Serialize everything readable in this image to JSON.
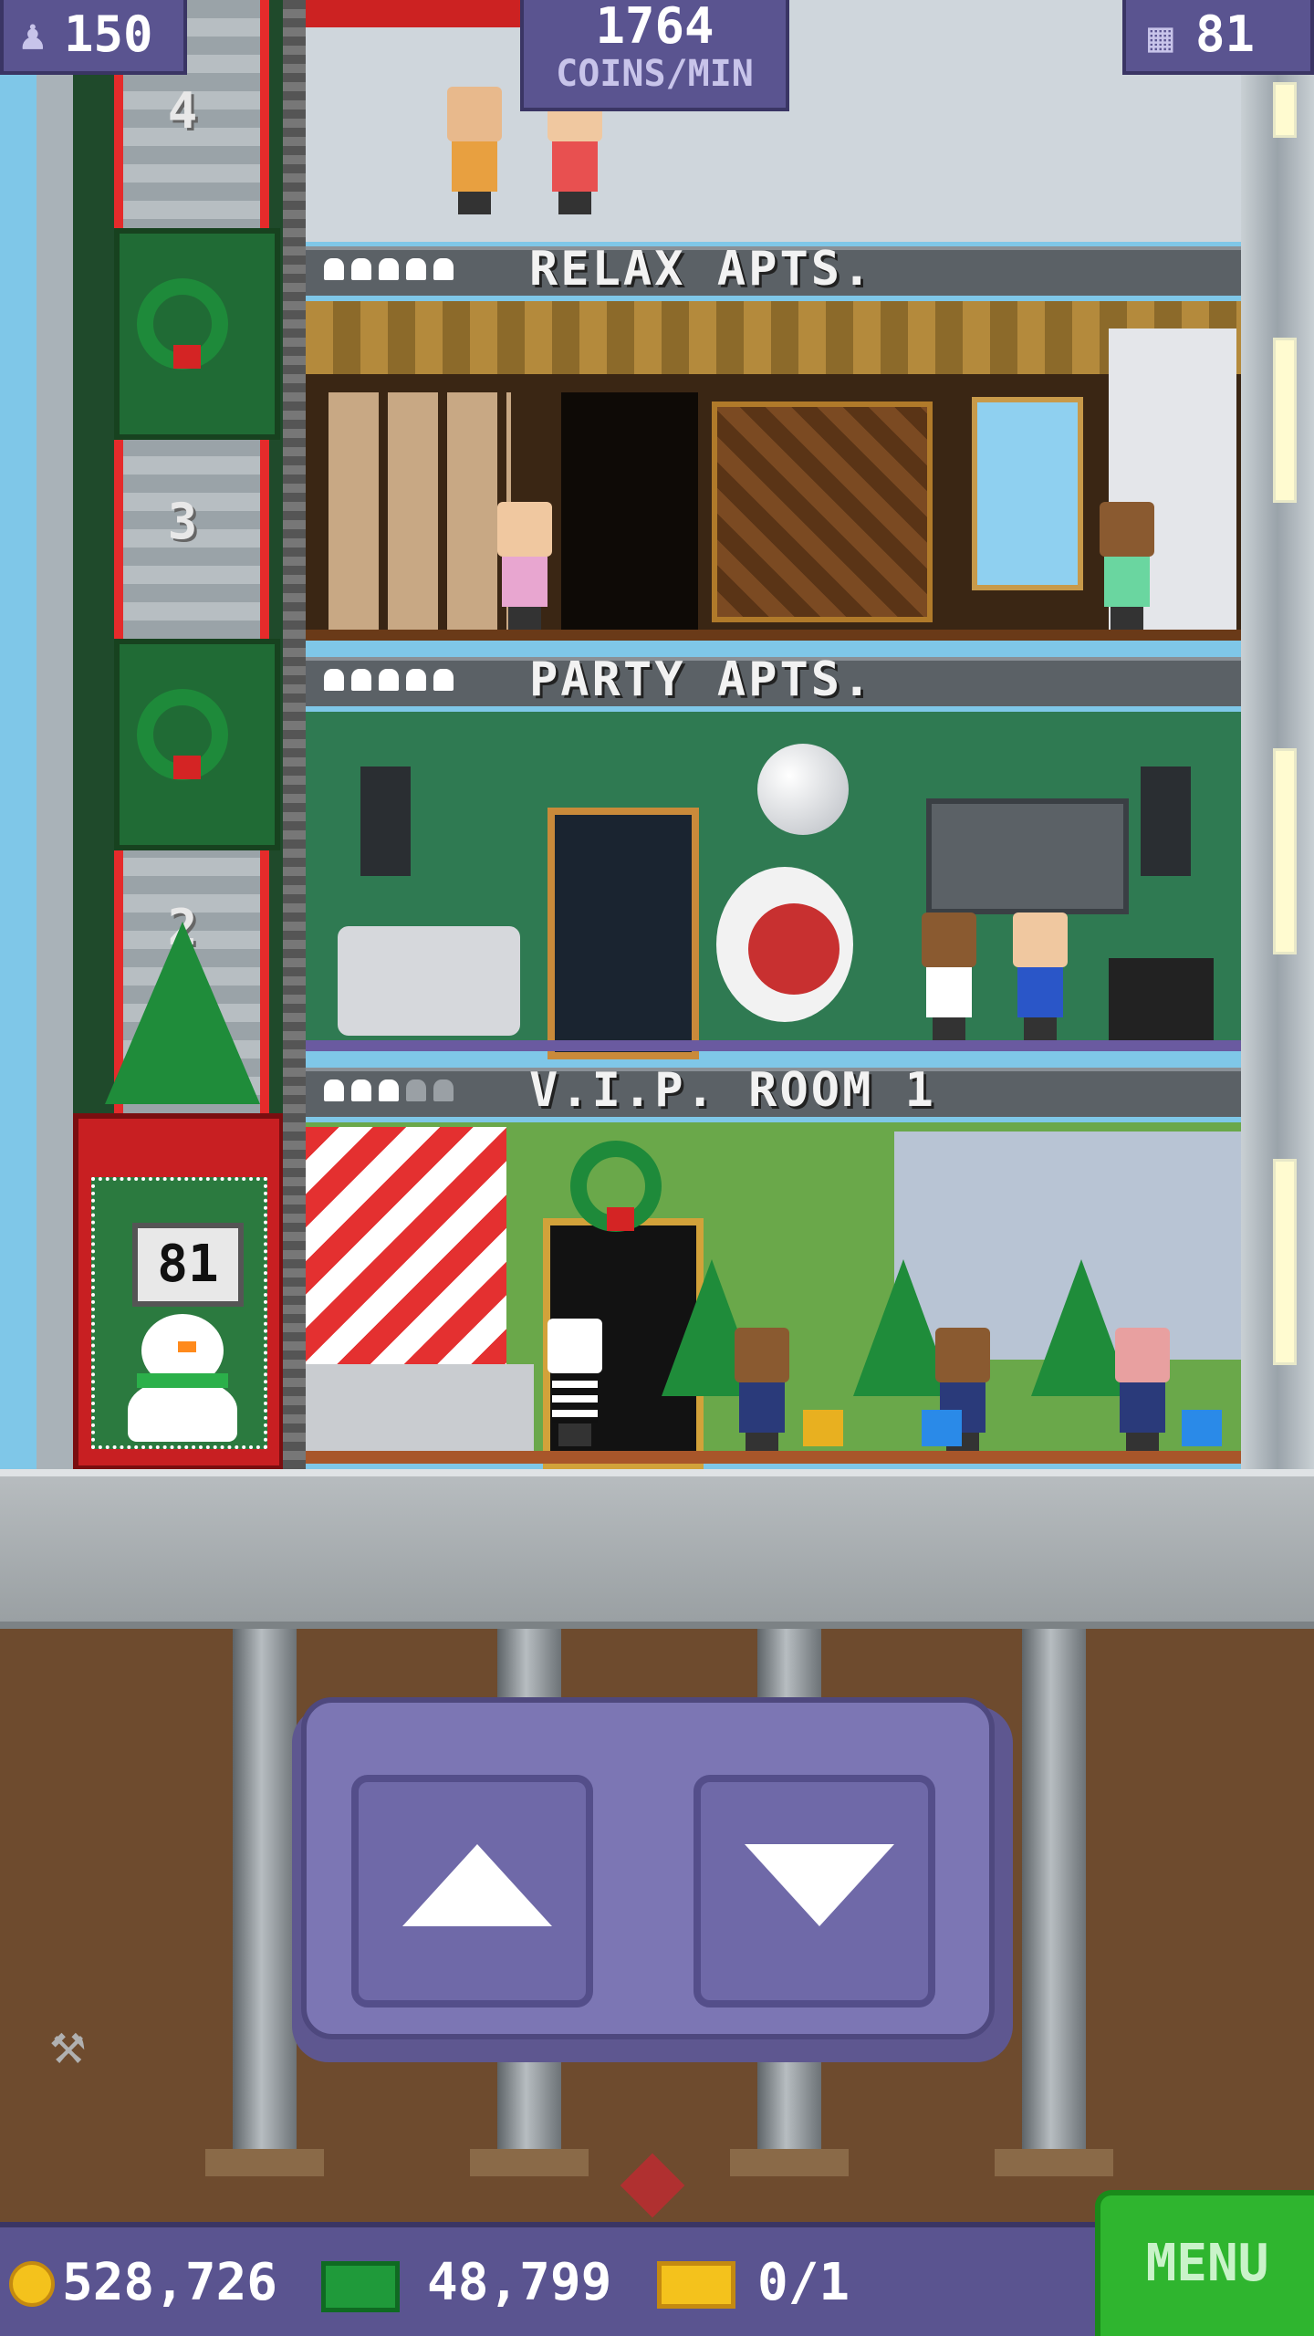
{
  "hud": {
    "population": "150",
    "coins_rate_value": "1764",
    "coins_rate_unit": "COINS/MIN",
    "floor_count": "81"
  },
  "elevator": {
    "shaft_floor_numbers": [
      "4",
      "3",
      "2"
    ],
    "current_floor": "81"
  },
  "floors": [
    {
      "name": "RELAX APTS.",
      "occupancy_filled": 5,
      "occupancy_total": 5
    },
    {
      "name": "PARTY APTS.",
      "occupancy_filled": 5,
      "occupancy_total": 5
    },
    {
      "name": "V.I.P. ROOM 1",
      "occupancy_filled": 3,
      "occupancy_total": 5
    }
  ],
  "controls": {
    "up_icon": "triangle-up",
    "down_icon": "triangle-down"
  },
  "bottom_bar": {
    "coins": "528,726",
    "tower_bux": "48,799",
    "tickets": "0/1",
    "menu_label": "MENU"
  },
  "colors": {
    "hud_purple": "#5a5490",
    "menu_green": "#2fb52f",
    "coin_gold": "#f4c21c",
    "bux_green": "#1f9a3a"
  }
}
